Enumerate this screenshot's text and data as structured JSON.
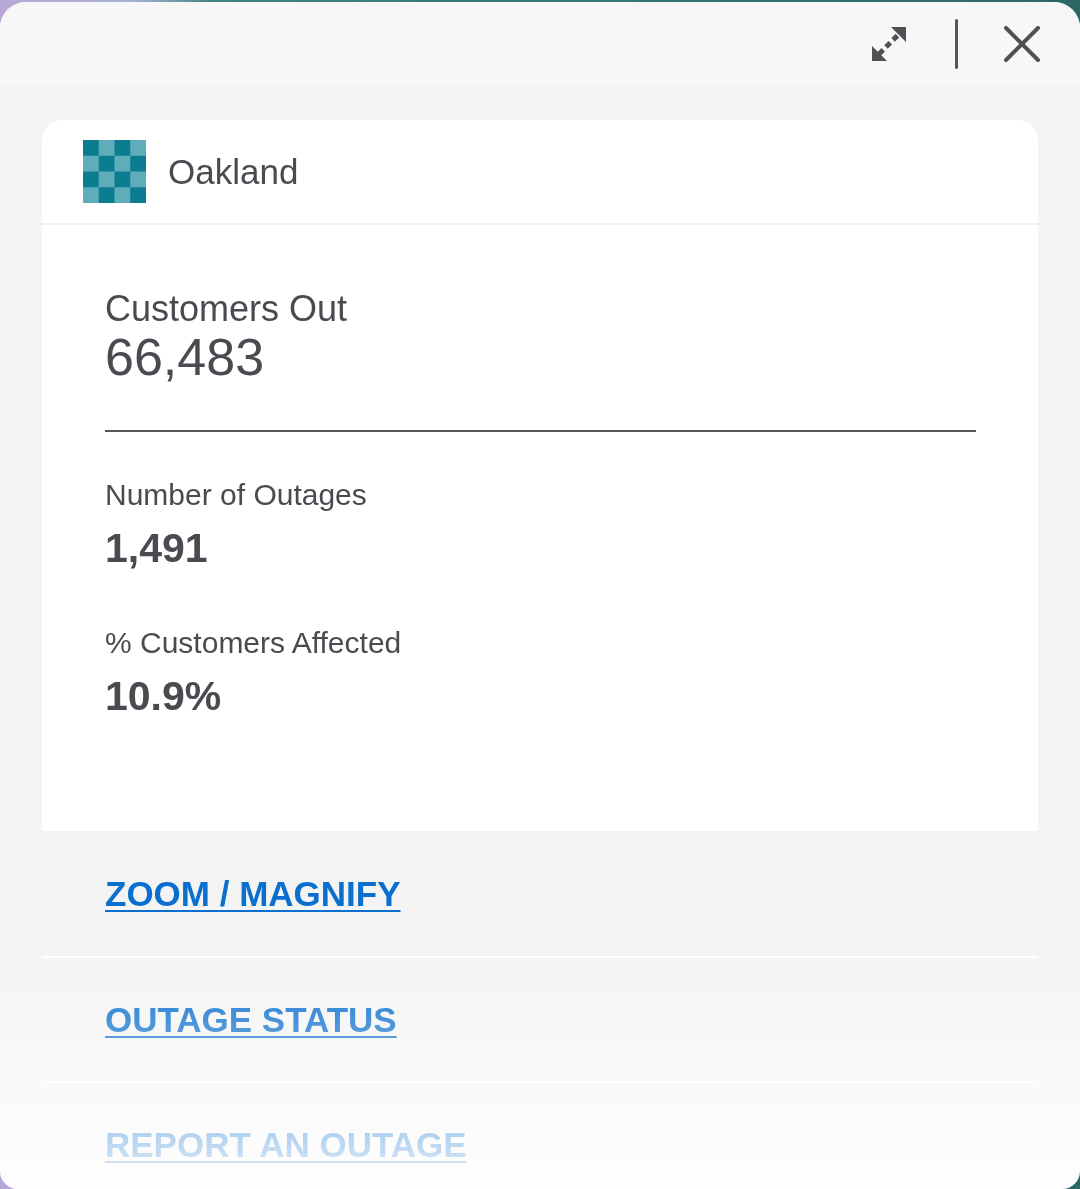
{
  "region": {
    "name": "Oakland"
  },
  "stats": [
    {
      "kind": "headline",
      "label": "Customers Out",
      "value": "66,483"
    },
    {
      "kind": "detail",
      "label": "Number of Outages",
      "value": "1,491"
    },
    {
      "kind": "detail",
      "label": "% Customers Affected",
      "value": "10.9%"
    }
  ],
  "links": [
    "ZOOM / MAGNIFY",
    "OUTAGE STATUS",
    "REPORT AN OUTAGE"
  ]
}
